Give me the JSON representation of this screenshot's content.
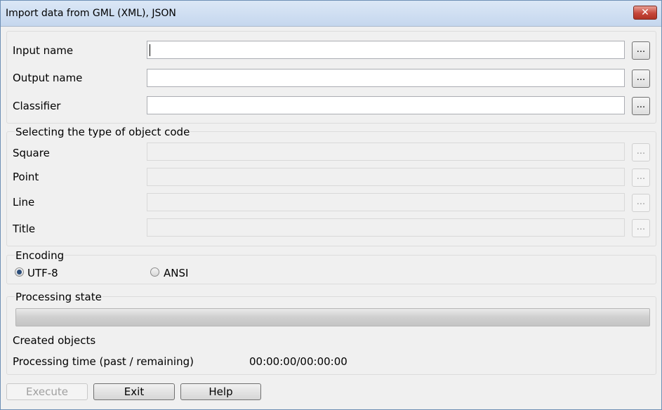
{
  "window": {
    "title": "Import data from GML (XML), JSON",
    "close_label": "✕"
  },
  "files": {
    "input_label": "Input name",
    "input_value": "",
    "output_label": "Output name",
    "output_value": "",
    "classifier_label": "Classifier",
    "classifier_value": "",
    "browse_label": "..."
  },
  "object_code": {
    "group_title": "Selecting the type of object code",
    "square_label": "Square",
    "point_label": "Point",
    "line_label": "Line",
    "title_label": "Title",
    "browse_label": "..."
  },
  "encoding": {
    "group_title": "Encoding",
    "options": [
      "UTF-8",
      "ANSI"
    ],
    "selected": "UTF-8"
  },
  "processing": {
    "group_title": "Processing state",
    "progress_fraction": 0,
    "created_label": "Created objects",
    "time_label": "Processing time (past / remaining)",
    "time_value": "00:00:00/00:00:00"
  },
  "buttons": {
    "execute": "Execute",
    "exit": "Exit",
    "help": "Help"
  },
  "colors": {
    "progress_fill": "#06b025",
    "close_button": "#c6463a"
  }
}
